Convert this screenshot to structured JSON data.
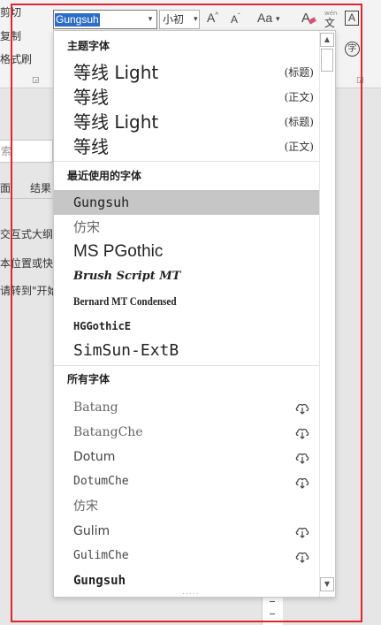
{
  "ribbon": {
    "clipboard": {
      "cut": "剪切",
      "copy": "复制",
      "format_painter": "格式刷"
    },
    "font_name": "Gungsuh",
    "font_size": "小初",
    "grow_font": "A",
    "shrink_font": "A",
    "change_case": "Aa",
    "phonetic_char": "文",
    "char_border": "A",
    "enclose_char": "字"
  },
  "nav_pane": {
    "search_placeholder": "索",
    "tab_headings": "面",
    "tab_results": "结果",
    "info_line_1": "交互式大纲",
    "info_line_2": "本位置或快",
    "info_line_3": "请转到\"开始"
  },
  "dropdown": {
    "theme_header": "主题字体",
    "theme_fonts": [
      {
        "name": "等线 Light",
        "tag": "(标题)"
      },
      {
        "name": "等线",
        "tag": "(正文)"
      },
      {
        "name": "等线 Light",
        "tag": "(标题)"
      },
      {
        "name": "等线",
        "tag": "(正文)"
      }
    ],
    "recent_header": "最近使用的字体",
    "recent_fonts": [
      {
        "name": "Gungsuh"
      },
      {
        "name": "仿宋"
      },
      {
        "name": "MS PGothic"
      },
      {
        "name": "Brush Script MT"
      },
      {
        "name": "Bernard MT Condensed"
      },
      {
        "name": "HGGothicE"
      },
      {
        "name": "SimSun-ExtB"
      }
    ],
    "all_header": "所有字体",
    "all_fonts": [
      {
        "name": "Batang",
        "cloud": true
      },
      {
        "name": "BatangChe",
        "cloud": true
      },
      {
        "name": "Dotum",
        "cloud": true
      },
      {
        "name": "DotumChe",
        "cloud": true
      },
      {
        "name": "仿宋",
        "cloud": false
      },
      {
        "name": "Gulim",
        "cloud": true
      },
      {
        "name": "GulimChe",
        "cloud": true
      },
      {
        "name": "Gungsuh",
        "cloud": false
      }
    ],
    "selected_font": "Gungsuh"
  },
  "colors": {
    "selection_highlight": "#2b6cc8",
    "selected_row": "#c6c6c6",
    "annotation": "#e0262b"
  }
}
